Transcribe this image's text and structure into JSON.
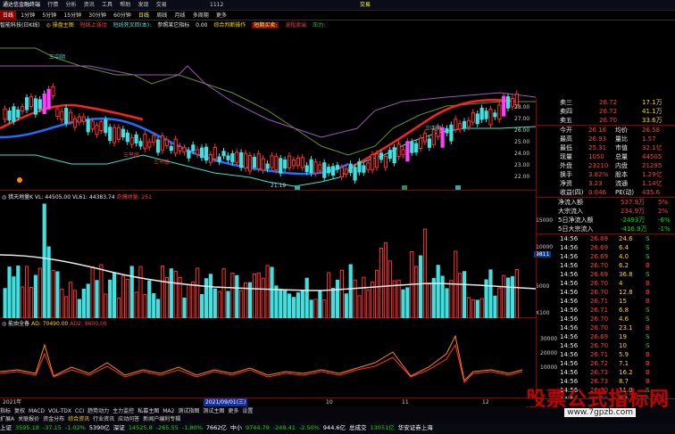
{
  "titlebar": {
    "app": "通达信金融终端",
    "menus": [
      "行情",
      "分析",
      "资讯",
      "工具",
      "帮助",
      "发现",
      "交易"
    ],
    "code": "1112",
    "right": "交易"
  },
  "period_tabs": [
    "日线",
    "1分钟",
    "5分钟",
    "15分钟",
    "30分钟",
    "60分钟",
    "日线",
    "周线",
    "月线",
    "多周期",
    "更多"
  ],
  "indicator_line": {
    "name": "智能科技(日K线)",
    "a": "◎ 操盘主图",
    "b": "短线上涨动",
    "c": "短线死叉回(本):",
    "d": "参照某它指标",
    "e": "0.00",
    "f": "综合判断操作",
    "g": "短期买卖:",
    "h": "波段卖出",
    "i": "压力:"
  },
  "chart_labels": {
    "t1": "三中阴",
    "t2": "三平底",
    "t3": "三平底",
    "t4": "三中阴",
    "low": "21.19",
    "right_hi": "27.00"
  },
  "price_axis": [
    "28.00",
    "27.00",
    "26.00",
    "25.00",
    "24.00",
    "23.00",
    "22.00"
  ],
  "orderbook": {
    "asks": [
      {
        "label": "卖三",
        "price": "26.72",
        "vol": "17.1万"
      },
      {
        "label": "卖四",
        "price": "26.72",
        "vol": "41.1万"
      },
      {
        "label": "卖五",
        "price": "26.70",
        "vol": "33.6万"
      }
    ],
    "stats": [
      {
        "l": "今开",
        "v": "26.16",
        "l2": "均价",
        "v2": "26.58"
      },
      {
        "l": "最高",
        "v": "26.93",
        "l2": "量比",
        "v2": "1.57"
      },
      {
        "l": "最低",
        "v": "25.31",
        "l2": "市值",
        "v2": "32.1亿"
      },
      {
        "l": "现量",
        "v": "1050",
        "l2": "总量",
        "v2": "44505"
      },
      {
        "l": "外盘",
        "v": "23210",
        "l2": "内盘",
        "v2": "21295"
      },
      {
        "l": "换手",
        "v": "3.82%",
        "l2": "股本",
        "v2": "1.29亿"
      },
      {
        "l": "净资",
        "v": "3.23",
        "l2": "流通",
        "v2": "1.14亿"
      },
      {
        "l": "收益(四)",
        "v": "0.046",
        "l2": "PE(动)",
        "v2": "435.6"
      }
    ],
    "flow": [
      {
        "l": "净流入额",
        "v": "537.9万",
        "p": "5%"
      },
      {
        "l": "大宗流入",
        "v": "234.9万",
        "p": "2%"
      },
      {
        "l": "5日净流入额",
        "v": "-2493万",
        "p": "-6%"
      },
      {
        "l": "5日大宗流入",
        "v": "-416.9万",
        "p": "-1%"
      }
    ],
    "ticks": [
      {
        "t": "14:56",
        "p": "26.69",
        "v": "24.6",
        "f": "S"
      },
      {
        "t": "14:56",
        "p": "26.69",
        "v": "6.4",
        "f": "S"
      },
      {
        "t": "14:56",
        "p": "26.69",
        "v": "4.0",
        "f": "S"
      },
      {
        "t": "14:56",
        "p": "26.70",
        "v": "6.2",
        "f": "B"
      },
      {
        "t": "14:56",
        "p": "26.69",
        "v": "36.8",
        "f": "S"
      },
      {
        "t": "14:56",
        "p": "26.70",
        "v": "4",
        "f": "B"
      },
      {
        "t": "14:56",
        "p": "26.70",
        "v": "12.8",
        "f": "B"
      },
      {
        "t": "14:56",
        "p": "26.71",
        "v": "15",
        "f": "B"
      },
      {
        "t": "14:56",
        "p": "26.71",
        "v": "6.8",
        "f": "S"
      },
      {
        "t": "14:56",
        "p": "26.70",
        "v": "4.6",
        "f": "S"
      },
      {
        "t": "14:56",
        "p": "26.70",
        "v": "23.1",
        "f": "B"
      },
      {
        "t": "14:56",
        "p": "26.69",
        "v": "19",
        "f": "S"
      },
      {
        "t": "14:56",
        "p": "26.70",
        "v": "10",
        "f": "S"
      },
      {
        "t": "14:56",
        "p": "26.71",
        "v": "5.9",
        "f": "B"
      },
      {
        "t": "14:56",
        "p": "26.72",
        "v": "7.1",
        "f": "B"
      },
      {
        "t": "14:56",
        "p": "26.73",
        "v": "16.2",
        "f": "B"
      },
      {
        "t": "14:56",
        "p": "26.73",
        "v": "8.7",
        "f": "B"
      },
      {
        "t": "14:56",
        "p": "26.70",
        "v": "11.0",
        "f": "S"
      },
      {
        "t": "14:56",
        "p": "26.70",
        "v": "9.1",
        "f": "S"
      }
    ]
  },
  "vol_panel": {
    "title": "◎ 猎天地量K",
    "vl": "VL: 44505.00",
    "vl1": "VL61: 44383.74",
    "extra": "奇偶地量: 251",
    "axis": [
      "15000",
      "10000",
      "5000",
      "X100"
    ],
    "marker": "9811"
  },
  "ad_panel": {
    "title": "◎ 能由全备",
    "ad": "AD: 70490.00",
    "ad2": "AD2: 9600.00",
    "axis": [
      "30000",
      "20000",
      "10000"
    ]
  },
  "x_axis": {
    "start": "2021年",
    "cursor": "2021/09/01(三)",
    "m1": "10",
    "m2": "11",
    "m3": "12"
  },
  "bottom_tabs": [
    "指标",
    "复权",
    "MACD",
    "VOL-TDX",
    "CCI",
    "趋势动力",
    "主力监控",
    "私募主图",
    "MA2",
    "测试指图",
    "测试主图",
    "更多",
    "设置"
  ],
  "bottom_tabs2": [
    "扩展A",
    "关联报价",
    "资金分布",
    "综合资讯",
    "行业资讯",
    "应动问答",
    "新闻户编利专辑"
  ],
  "status": [
    {
      "name": "上证",
      "val": "3595.18",
      "chg": "-37.15",
      "pct": "-1.02%",
      "amt": "5390亿"
    },
    {
      "name": "深证",
      "val": "14525.8",
      "chg": "-265.55",
      "pct": "-1.80%",
      "amt": "7662亿"
    },
    {
      "name": "中小",
      "val": "9744.79",
      "chg": "-249.41",
      "pct": "-2.50%",
      "amt": "944.6亿"
    },
    {
      "name": "总成交",
      "val": "13051亿",
      "chg": "",
      "pct": "",
      "amt": "华安证券上海"
    }
  ],
  "watermark": {
    "text": "股票公式指标网",
    "url": "www.7gpzb.com"
  }
}
